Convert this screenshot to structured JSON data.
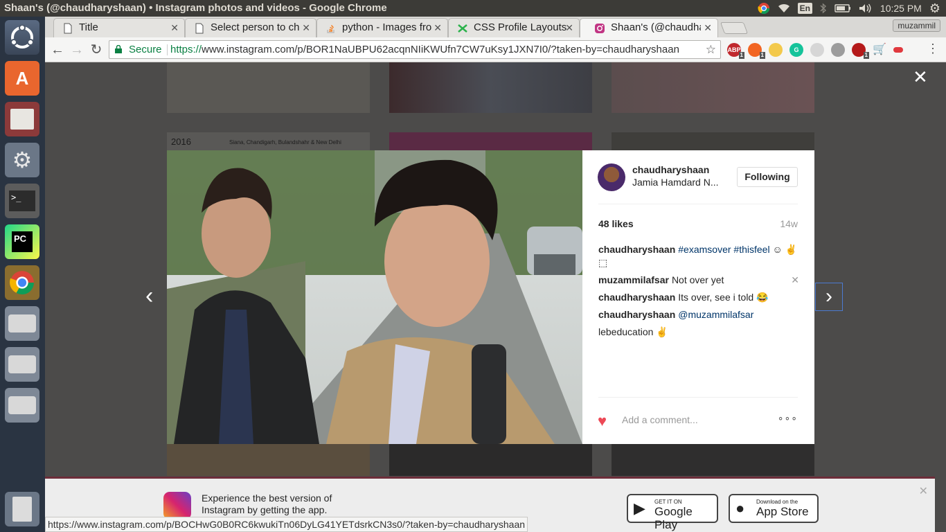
{
  "system_panel": {
    "window_title": "Shaan's (@chaudharyshaan) • Instagram photos and videos - Google Chrome",
    "keyboard_layout": "En",
    "clock": "10:25 PM",
    "icons": [
      "chrome-icon",
      "wifi-icon",
      "bluetooth-icon",
      "battery-icon",
      "volume-icon",
      "gear-icon"
    ]
  },
  "launcher": {
    "items": [
      "ubuntu-dash",
      "software-center",
      "file-manager",
      "system-settings",
      "terminal",
      "pycharm",
      "chrome",
      "disk-drive",
      "disk-drive",
      "disk-drive",
      "trash"
    ]
  },
  "browser": {
    "tabs": [
      {
        "label": "Title",
        "favicon": "document"
      },
      {
        "label": "Select person to ch",
        "favicon": "document"
      },
      {
        "label": "python - Images fro",
        "favicon": "stackoverflow"
      },
      {
        "label": "CSS Profile Layouts",
        "favicon": "codepen"
      },
      {
        "label": "Shaan's (@chaudha",
        "favicon": "instagram",
        "active": true
      }
    ],
    "profile_name": "muzammil",
    "omnibox": {
      "secure_label": "Secure",
      "url_scheme": "https://",
      "url_rest": "www.instagram.com/p/BOR1NaUBPU62acqnNIiKWUfn7CW7uKsy1JXN7I0/?taken-by=chaudharyshaan"
    },
    "extension_badges": [
      "1",
      "1",
      "1"
    ],
    "status_url": "https://www.instagram.com/p/BOCHwG0B0RC6kwukiTn06DyLG41YETdsrkCN3s0/?taken-by=chaudharyshaan"
  },
  "background": {
    "tile_year": "2016",
    "tile_places": "Siana, Chandigarh, Bulandshahr & New Delhi",
    "banner": {
      "text": "Experience the best version of Instagram by getting the app.",
      "google_play_small": "GET IT ON",
      "google_play_big": "Google Play",
      "app_store_small": "Download on the",
      "app_store_big": "App Store"
    }
  },
  "modal": {
    "post": {
      "username": "chaudharyshaan",
      "location": "Jamia Hamdard N...",
      "follow_label": "Following",
      "likes": "48 likes",
      "time_ago": "14w",
      "comments": [
        {
          "user": "chaudharyshaan",
          "text": "",
          "hashtags": "#examsover #thisfeel",
          "emoji": "☺ ✌⬚"
        },
        {
          "user": "muzammilafsar",
          "text": "Not over yet"
        },
        {
          "user": "chaudharyshaan",
          "text": "Its over, see i told 😂"
        },
        {
          "user": "chaudharyshaan",
          "mention": "@muzammilafsar"
        },
        {
          "user": "",
          "text": "lebeducation ✌"
        }
      ],
      "comment_placeholder": "Add a comment...",
      "more_options": "∘∘∘"
    }
  },
  "colors": {
    "instagram_link": "#003569",
    "heart_red": "#ed4956",
    "secure_green": "#0b8043",
    "launcher_bg": "#2a3442"
  }
}
